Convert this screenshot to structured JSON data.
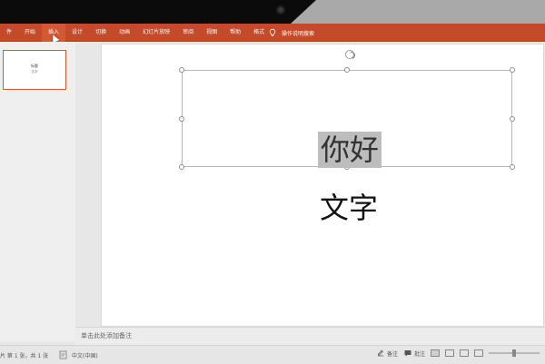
{
  "ribbon": {
    "tabs": [
      "件",
      "开始",
      "插入",
      "设计",
      "切换",
      "动画",
      "幻灯片放映",
      "审阅",
      "视图",
      "帮助",
      "格式"
    ],
    "active_tab_index": 2,
    "help_search_label": "操作说明搜索",
    "colors": {
      "bar": "#c44b28",
      "active": "#d25a35"
    }
  },
  "thumbnail": {
    "title": "标题",
    "subtitle": "文字"
  },
  "slide": {
    "selected_text": "你好",
    "body_text": "文字"
  },
  "notes": {
    "placeholder": "单击此处添加备注"
  },
  "status": {
    "slide_info": "片 第 1 张，共 1 张",
    "language": "中文(中国)",
    "notes_label": "备注",
    "comments_label": "批注"
  },
  "icons": {
    "help": "lightbulb-icon",
    "spell": "proofing-icon",
    "notes": "notes-icon",
    "comments": "comments-icon",
    "rotate": "rotate-icon"
  }
}
